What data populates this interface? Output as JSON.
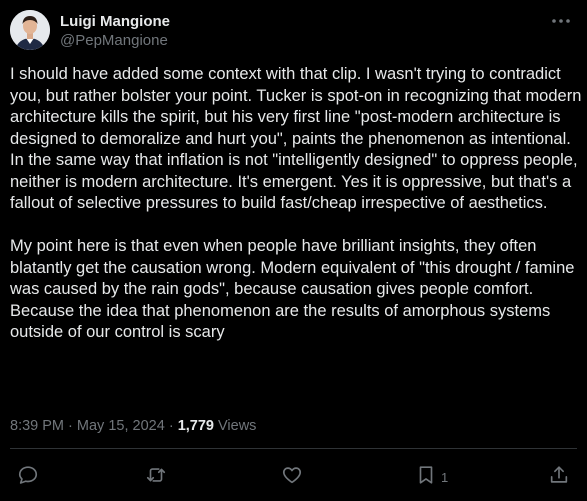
{
  "author": {
    "display_name": "Luigi Mangione",
    "handle": "@PepMangione"
  },
  "tweet": {
    "paragraph_1": "I should have added some context with that clip. I wasn't trying to contradict you, but rather bolster your point. Tucker is spot-on in recognizing that modern architecture kills the spirit, but his very first line \"post-modern architecture is designed to demoralize and hurt you\", paints the phenomenon as intentional. In the same way that inflation is not \"intelligently designed\" to oppress people, neither is modern architecture. It's emergent. Yes it is oppressive, but that's a fallout of selective pressures to build fast/cheap irrespective of aesthetics.",
    "paragraph_2": "My point here is that even when people have brilliant insights, they often blatantly get the causation wrong. Modern equivalent of \"this drought / famine was caused by the rain gods\", because causation gives people comfort. Because the idea that phenomenon are the results of amorphous systems outside of our control is scary"
  },
  "meta": {
    "time": "8:39 PM",
    "date": "May 15, 2024",
    "separator": "·",
    "views_count": "1,779",
    "views_label": "Views"
  },
  "actions": {
    "bookmarks_count": "1"
  },
  "icons": {
    "more": "more-horizontal-icon",
    "reply": "reply-icon",
    "retweet": "retweet-icon",
    "like": "like-icon",
    "bookmark": "bookmark-icon",
    "share": "share-icon"
  },
  "colors": {
    "background": "#000000",
    "text": "#e7e9ea",
    "secondary": "#71767b",
    "divider": "#2f3336"
  }
}
